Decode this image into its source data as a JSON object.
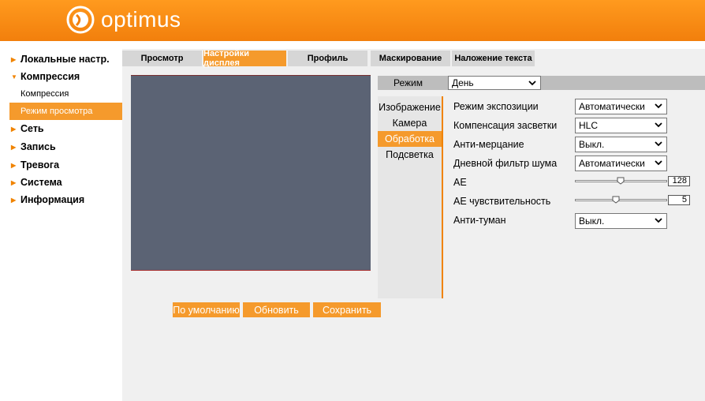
{
  "header": {
    "brand": "optimus",
    "logo_icon": "optimus-logo-icon",
    "bg_color": "#f68d18"
  },
  "sidebar": {
    "items": [
      {
        "label": "Локальные настр."
      },
      {
        "label": "Компрессия"
      },
      {
        "label": "Сеть"
      },
      {
        "label": "Запись"
      },
      {
        "label": "Тревога"
      },
      {
        "label": "Система"
      },
      {
        "label": "Информация"
      }
    ],
    "sub_items": [
      {
        "label": "Компрессия"
      },
      {
        "label": "Режим просмотра"
      }
    ]
  },
  "tabs": [
    {
      "label": "Просмотр"
    },
    {
      "label": "Настройки дисплея"
    },
    {
      "label": "Профиль"
    },
    {
      "label": "Маскирование"
    },
    {
      "label": "Наложение текста"
    }
  ],
  "mode": {
    "label": "Режим",
    "value": "День"
  },
  "subpanel": {
    "items": [
      {
        "label": "Изображение"
      },
      {
        "label": "Камера"
      },
      {
        "label": "Обработка"
      },
      {
        "label": "Подсветка"
      }
    ]
  },
  "settings": {
    "exposure": {
      "label": "Режим экспозиции",
      "value": "Автоматически"
    },
    "backlight": {
      "label": "Компенсация засветки",
      "value": "HLC"
    },
    "antiflicker": {
      "label": "Анти-мерцание",
      "value": "Выкл."
    },
    "noise": {
      "label": "Дневной фильтр шума",
      "value": "Автоматически"
    },
    "ae": {
      "label": "AE",
      "value": "128"
    },
    "ae_sens": {
      "label": "AE чувствительность",
      "value": "5"
    },
    "antifog": {
      "label": "Анти-туман",
      "value": "Выкл."
    }
  },
  "buttons": {
    "default": "По умолчанию",
    "refresh": "Обновить",
    "save": "Сохранить"
  },
  "colors": {
    "accent": "#f59a2c",
    "preview": "#5b6374"
  }
}
